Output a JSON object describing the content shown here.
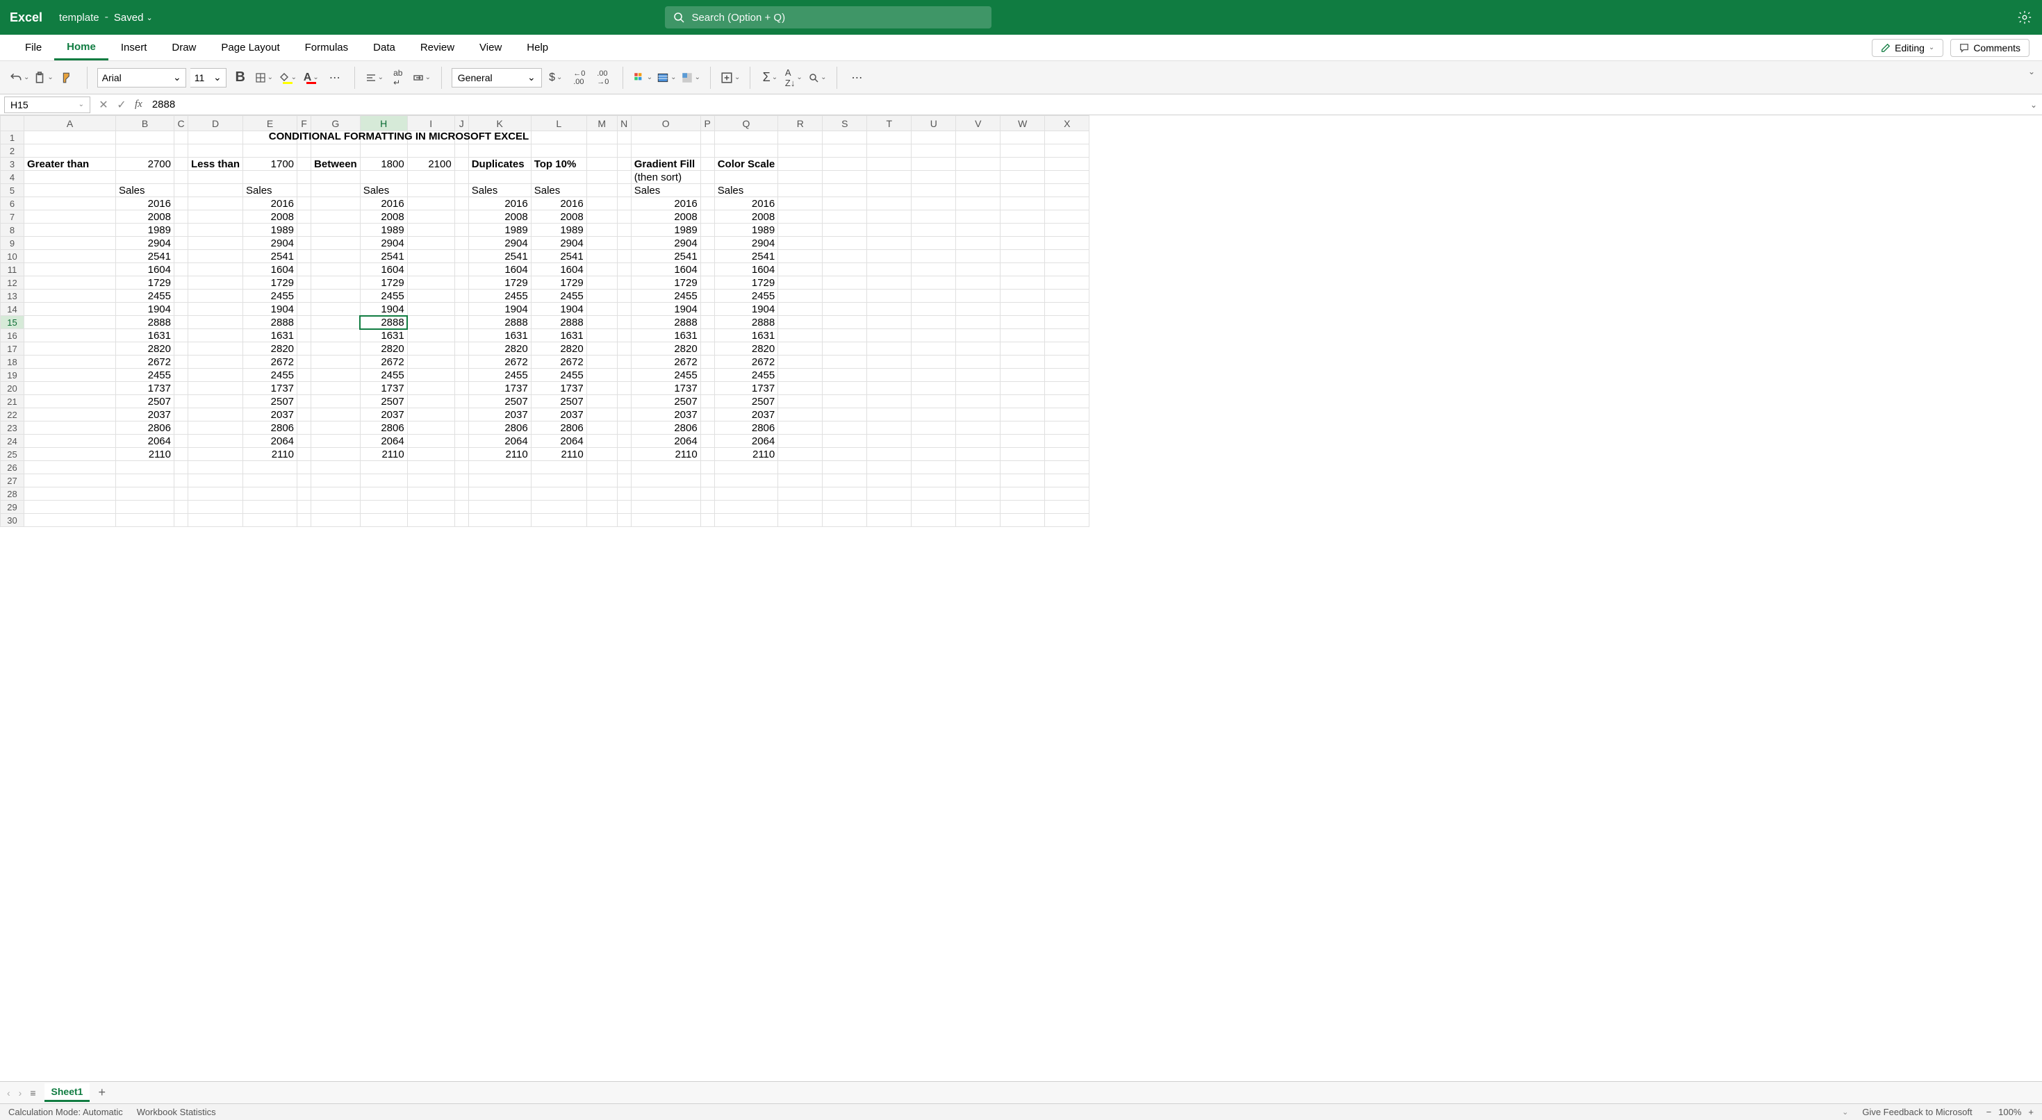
{
  "titlebar": {
    "app": "Excel",
    "doc": "template",
    "saved": "Saved",
    "search_placeholder": "Search (Option + Q)"
  },
  "tabs": [
    "File",
    "Home",
    "Insert",
    "Draw",
    "Page Layout",
    "Formulas",
    "Data",
    "Review",
    "View",
    "Help"
  ],
  "active_tab": "Home",
  "editing_btn": "Editing",
  "comments_btn": "Comments",
  "ribbon": {
    "font_name": "Arial",
    "font_size": "11",
    "number_format": "General"
  },
  "formula_bar": {
    "name_box": "H15",
    "formula": "2888"
  },
  "columns": [
    "A",
    "B",
    "C",
    "D",
    "E",
    "F",
    "G",
    "H",
    "I",
    "J",
    "K",
    "L",
    "M",
    "N",
    "O",
    "P",
    "Q",
    "R",
    "S",
    "T",
    "U",
    "V",
    "W",
    "X"
  ],
  "col_widths": {
    "A": 132,
    "B": 84,
    "C": 20,
    "D": 78,
    "E": 78,
    "F": 20,
    "G": 68,
    "H": 68,
    "I": 68,
    "J": 20,
    "K": 90,
    "L": 80,
    "M": 44,
    "N": 20,
    "O": 100,
    "P": 20,
    "Q": 90,
    "R": 64,
    "S": 64,
    "T": 64,
    "U": 64,
    "V": 64,
    "W": 64,
    "X": 64
  },
  "selected_col": "H",
  "selected_row": 15,
  "row_count": 30,
  "title_cell": "CONDITIONAL FORMATTING IN MICROSOFT EXCEL",
  "headers_row3": {
    "A": "Greater than",
    "B": "2700",
    "D": "Less than",
    "E": "1700",
    "G": "Between",
    "H": "1800",
    "I": "2100",
    "K": "Duplicates",
    "L": "Top 10%",
    "O": "Gradient Fill",
    "Q": "Color Scale"
  },
  "headers_row4": {
    "O": "(then sort)"
  },
  "sales_label": "Sales",
  "sales_cols": [
    "B",
    "E",
    "H",
    "K",
    "L",
    "O",
    "Q"
  ],
  "data_values": [
    2016,
    2008,
    1989,
    2904,
    2541,
    1604,
    1729,
    2455,
    1904,
    2888,
    1631,
    2820,
    2672,
    2455,
    1737,
    2507,
    2037,
    2806,
    2064,
    2110
  ],
  "sheet_tabs": {
    "active": "Sheet1"
  },
  "status": {
    "calc": "Calculation Mode: Automatic",
    "wb_stats": "Workbook Statistics",
    "feedback": "Give Feedback to Microsoft",
    "zoom": "100%"
  }
}
